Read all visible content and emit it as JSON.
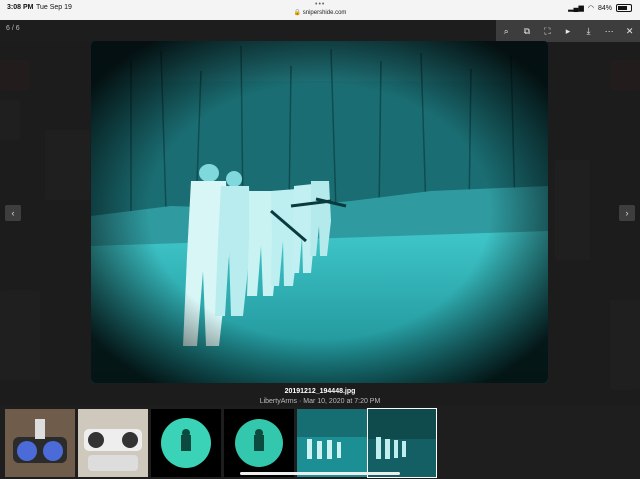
{
  "status_bar": {
    "time": "3:08 PM",
    "date": "Tue Sep 19",
    "url": "snipershide.com",
    "battery": "84%"
  },
  "lightbox": {
    "counter": "6 / 6",
    "toolbar_icons": [
      "search-icon",
      "share-icon",
      "fullscreen-icon",
      "play-icon",
      "download-icon",
      "more-icon",
      "close-icon"
    ],
    "prev_label": "‹",
    "next_label": "›",
    "image_title": "20191212_194448.jpg",
    "image_meta": "LibertyArms · Mar 10, 2020 at 7:20 PM"
  },
  "thumbnails": [
    {
      "name": "thumb-night-vision-goggles-1",
      "selected": false
    },
    {
      "name": "thumb-night-vision-goggles-2",
      "selected": false
    },
    {
      "name": "thumb-target-green-1",
      "selected": false
    },
    {
      "name": "thumb-target-green-2",
      "selected": false
    },
    {
      "name": "thumb-range-night-5",
      "selected": false
    },
    {
      "name": "thumb-range-night-6",
      "selected": true
    }
  ],
  "colors": {
    "nv_teal": "#1fb3b8",
    "nv_dark": "#0b3b40",
    "overlay": "#161616"
  }
}
